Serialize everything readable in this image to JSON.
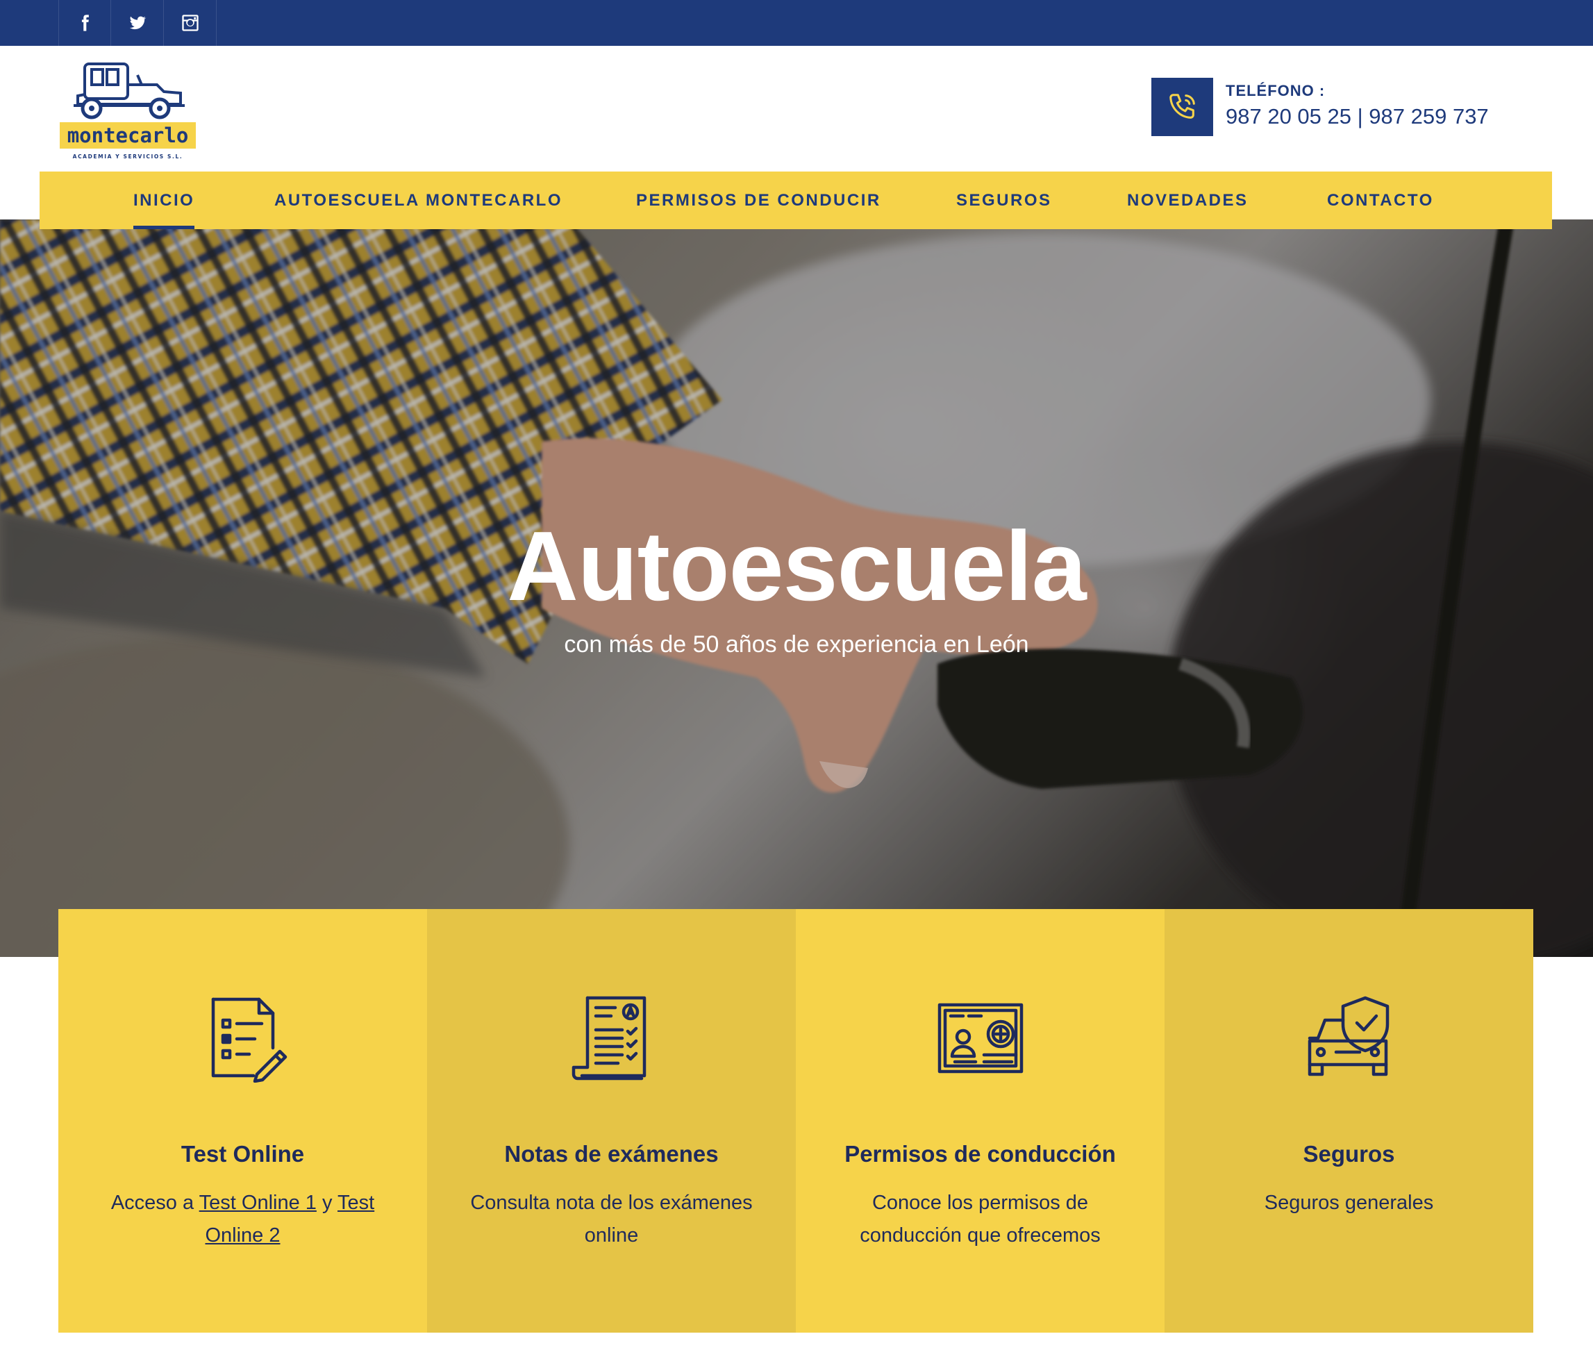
{
  "social": [
    {
      "icon": "facebook-icon"
    },
    {
      "icon": "twitter-icon"
    },
    {
      "icon": "instagram-icon"
    }
  ],
  "header": {
    "logo_text": "montecarlo",
    "logo_subtext": "ACADEMIA Y SERVICIOS S.L.",
    "phone_label": "TELÉFONO :",
    "phone_number": "987 20 05 25 | 987 259 737"
  },
  "nav": {
    "items": [
      {
        "label": "INICIO",
        "active": true
      },
      {
        "label": "AUTOESCUELA MONTECARLO",
        "active": false
      },
      {
        "label": "PERMISOS DE CONDUCIR",
        "active": false
      },
      {
        "label": "SEGUROS",
        "active": false
      },
      {
        "label": "NOVEDADES",
        "active": false
      },
      {
        "label": "CONTACTO",
        "active": false
      }
    ]
  },
  "hero": {
    "title": "Autoescuela",
    "subtitle": "con más de 50 años de experiencia en León"
  },
  "cards": [
    {
      "icon": "test-checklist-icon",
      "title": "Test Online",
      "text_prefix": "Acceso a ",
      "link1": "Test Online 1",
      "text_middle": " y ",
      "link2": "Test Online 2"
    },
    {
      "icon": "exam-results-icon",
      "title": "Notas de exámenes",
      "text": "Consulta nota de los exámenes online"
    },
    {
      "icon": "driving-license-icon",
      "title": "Permisos de conducción",
      "text": "Conoce los permisos de conducción que ofrecemos"
    },
    {
      "icon": "car-insurance-icon",
      "title": "Seguros",
      "text": "Seguros generales"
    }
  ],
  "colors": {
    "navy": "#1e3a7b",
    "yellow": "#f6d34a",
    "yellow_dark": "#e5c446",
    "card_text": "#1e2a5c"
  }
}
